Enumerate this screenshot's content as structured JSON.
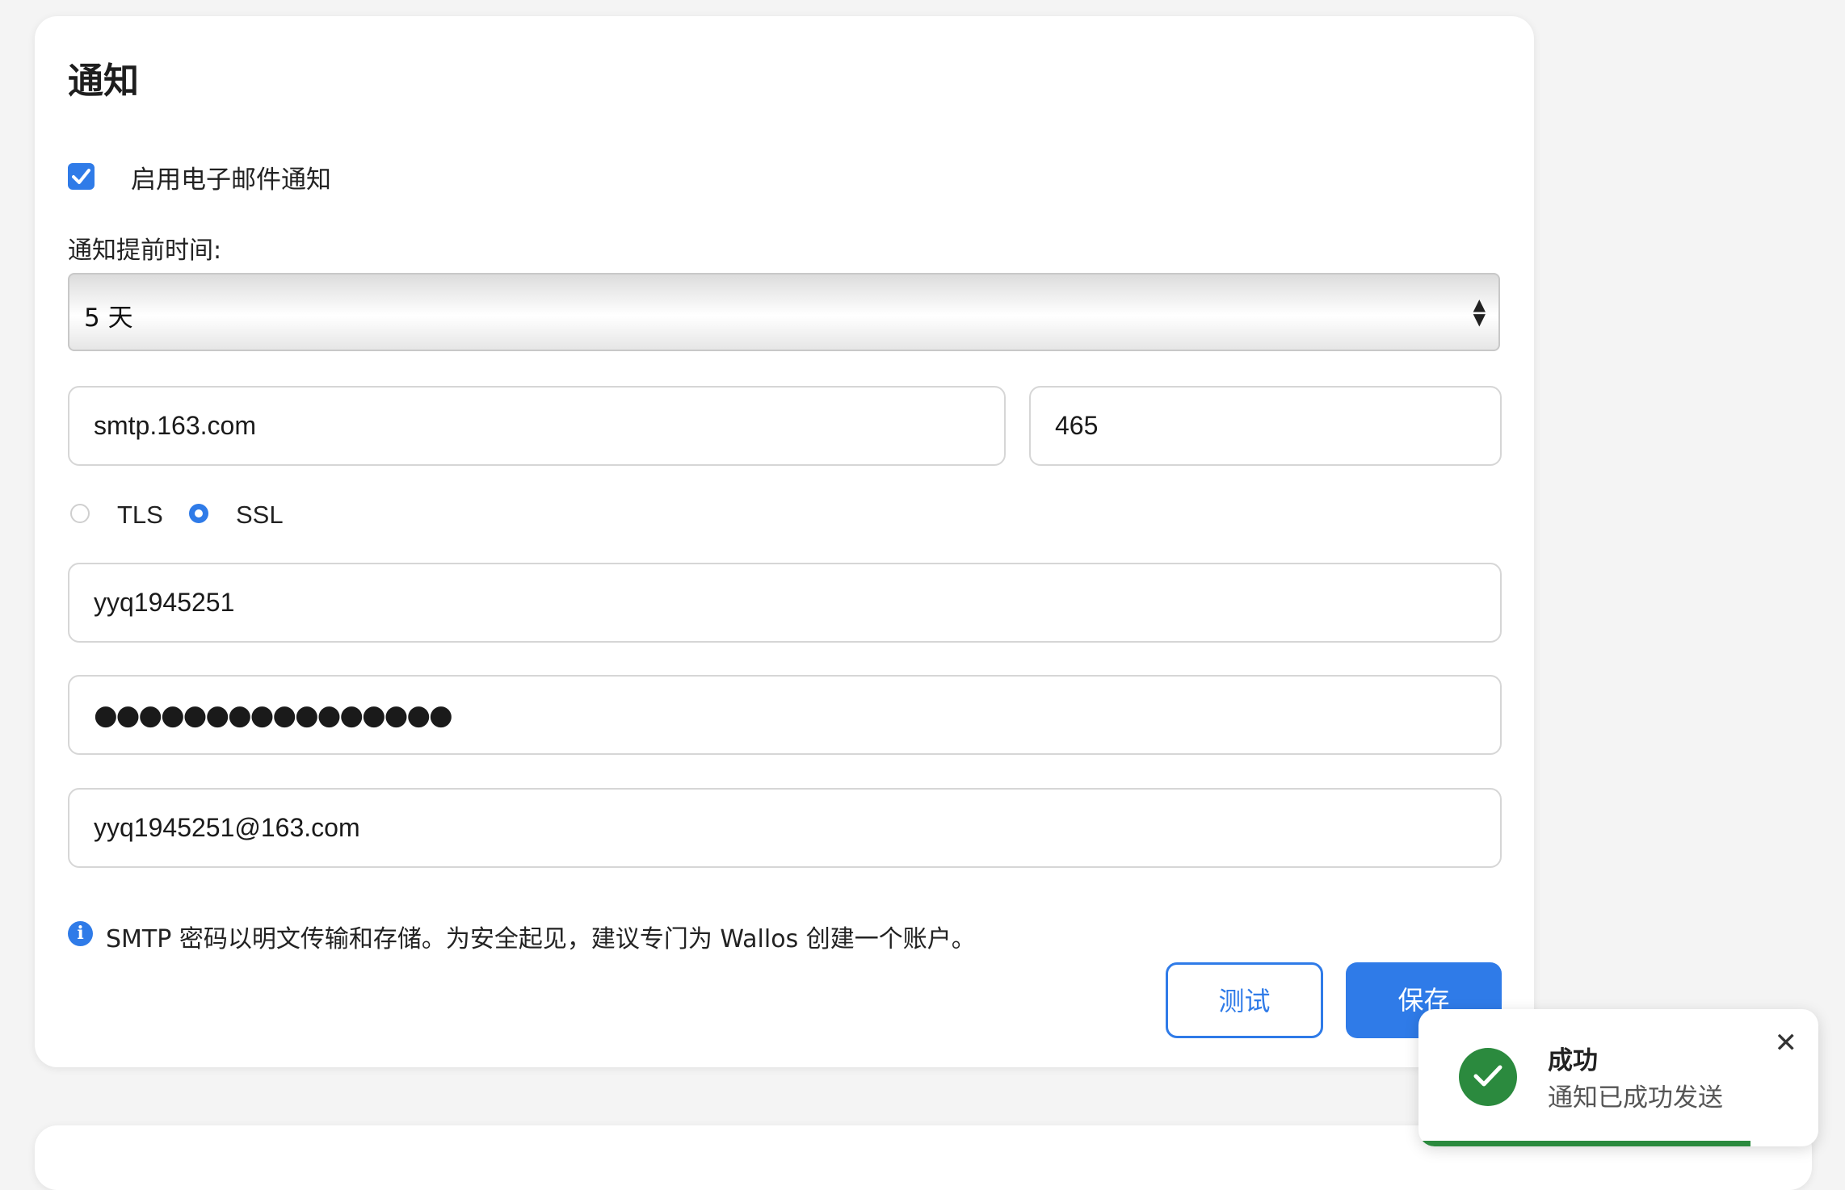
{
  "section": {
    "title": "通知",
    "enable_email_label": "启用电子邮件通知",
    "enable_email_checked": true,
    "lead_time_label": "通知提前时间:",
    "lead_time_value": "5 天"
  },
  "smtp": {
    "host": "smtp.163.com",
    "port": "465",
    "encryption_options": [
      "TLS",
      "SSL"
    ],
    "encryption_selected": "SSL",
    "username": "yyq1945251",
    "password_masked": "●●●●●●●●●●●●●●●●",
    "from_email": "yyq1945251@163.com"
  },
  "info": {
    "text": "SMTP 密码以明文传输和存储。为安全起见，建议专门为 Wallos 创建一个账户。"
  },
  "buttons": {
    "test_label": "测试",
    "save_label": "保存"
  },
  "toast": {
    "title": "成功",
    "message": "通知已成功发送",
    "progress_fraction": 0.83,
    "color": "#2b8a3e"
  },
  "colors": {
    "accent": "#2f7be8",
    "success": "#2b8a3e"
  }
}
